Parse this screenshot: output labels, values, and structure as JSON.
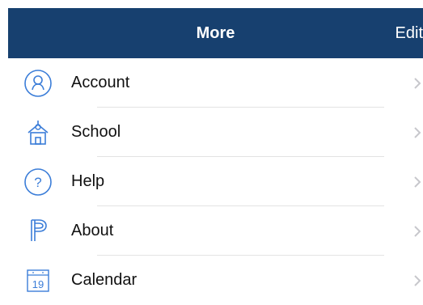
{
  "navbar": {
    "title": "More",
    "edit_label": "Edit"
  },
  "menu": {
    "items": [
      {
        "label": "Account",
        "icon": "account-icon"
      },
      {
        "label": "School",
        "icon": "school-icon"
      },
      {
        "label": "Help",
        "icon": "help-icon"
      },
      {
        "label": "About",
        "icon": "powerschool-logo-icon"
      },
      {
        "label": "Calendar",
        "icon": "calendar-icon",
        "calendar_day": "19"
      }
    ]
  },
  "colors": {
    "navbar_bg": "#17406f",
    "navbar_text": "#ffffff",
    "icon_accent": "#3b7dd8",
    "chevron": "#c7c7cc"
  }
}
